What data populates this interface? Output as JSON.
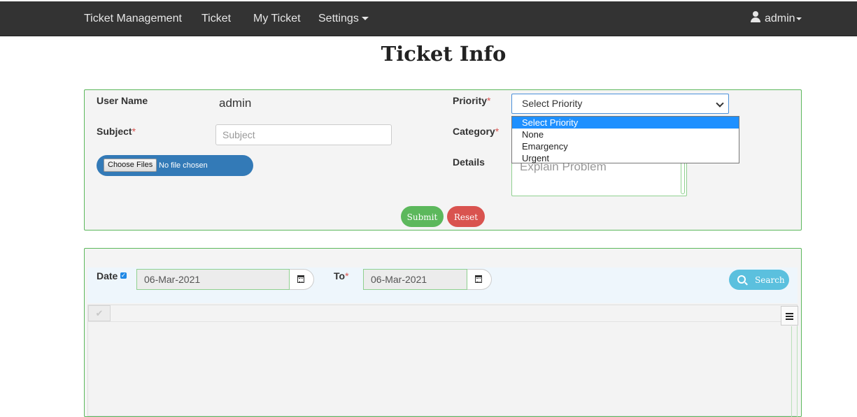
{
  "navbar": {
    "brand": "Ticket Management",
    "links": [
      "Ticket",
      "My Ticket"
    ],
    "settings_label": "Settings",
    "user_label": "admin",
    "icons": {
      "user": "user-icon",
      "settings_caret": "caret-down-icon"
    }
  },
  "page": {
    "title": "Ticket Info"
  },
  "form": {
    "user_name_label": "User Name",
    "user_name_value": "admin",
    "subject_label": "Subject",
    "subject_placeholder": "Subject",
    "required_mark": "*",
    "file_button": "Choose Files",
    "file_status": "No file chosen",
    "priority_label": "Priority",
    "priority_selected": "Select Priority",
    "priority_options": [
      "Select Priority",
      "None",
      "Emargency",
      "Urgent"
    ],
    "category_label": "Category",
    "details_label": "Details",
    "details_placeholder": "Explain Problem",
    "submit_label": "Submit",
    "reset_label": "Reset"
  },
  "filter": {
    "date_label": "Date",
    "date_checked": true,
    "date_from": "06-Mar-2021",
    "to_label": "To",
    "date_to": "06-Mar-2021",
    "search_label": "Search",
    "icons": {
      "calendar": "calendar-icon",
      "search": "search-icon",
      "menu": "hamburger-icon"
    }
  },
  "colors": {
    "navbar_bg": "#333333",
    "panel_border": "#5cb85c",
    "submit": "#5cb85c",
    "reset": "#d9534f",
    "search": "#5bc0de",
    "file_pill": "#337ab7",
    "dropdown_highlight": "#1e90ff"
  }
}
